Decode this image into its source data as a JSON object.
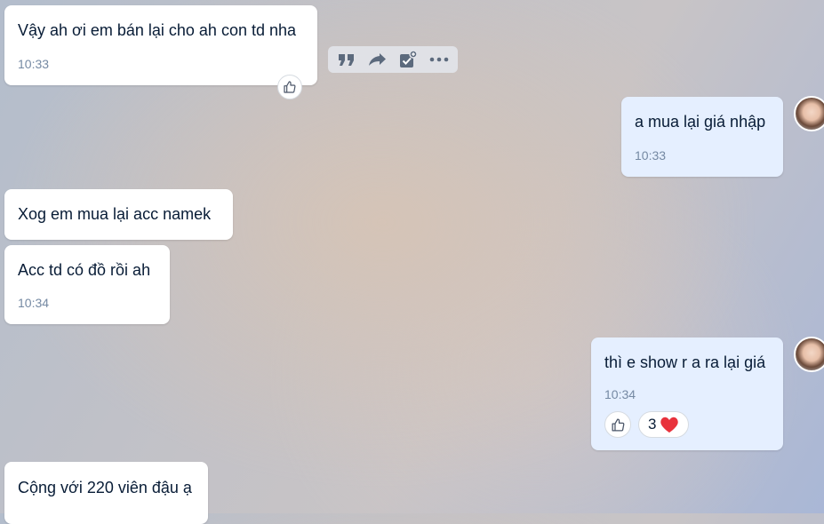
{
  "colors": {
    "incoming_bubble": "#ffffff",
    "outgoing_bubble": "#e5efff",
    "text": "#081c36",
    "time": "#7589a3",
    "heart": "#e8323c"
  },
  "toolbar": {
    "icons": [
      "quote-icon",
      "forward-icon",
      "add-task-icon",
      "more-icon"
    ]
  },
  "messages": [
    {
      "side": "incoming",
      "text": "Vậy ah ơi em bán lại cho ah con td nha",
      "time": "10:33"
    },
    {
      "side": "outgoing",
      "text": "a mua lại giá nhập",
      "time": "10:33"
    },
    {
      "side": "incoming",
      "text": "Xog em mua lại acc namek",
      "time": ""
    },
    {
      "side": "incoming",
      "text": "Acc td có đồ rồi ah",
      "time": "10:34"
    },
    {
      "side": "outgoing",
      "text": "thì e show r a ra lại giá",
      "time": "10:34",
      "reaction_count": "3",
      "reaction_icon": "heart-icon"
    },
    {
      "side": "incoming",
      "text": "Cộng với 220 viên đậu ạ",
      "time": ""
    }
  ]
}
